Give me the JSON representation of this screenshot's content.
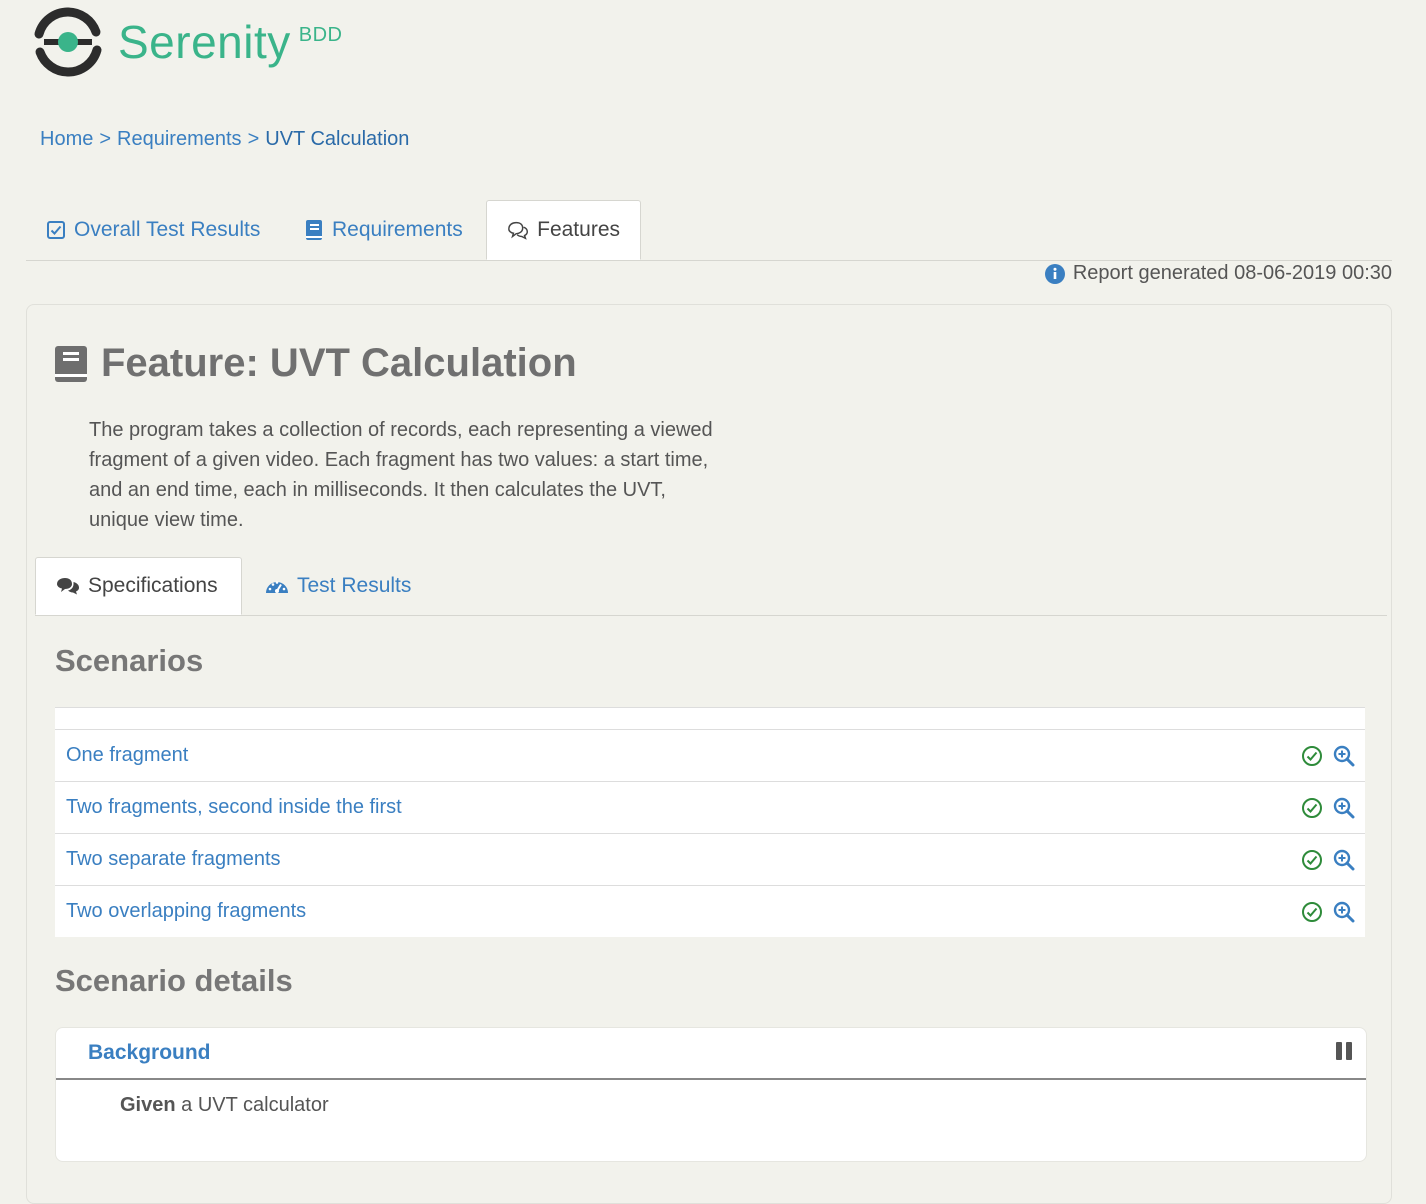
{
  "brand": {
    "name": "Serenity",
    "suffix": "BDD"
  },
  "breadcrumb": [
    {
      "label": "Home"
    },
    {
      "label": "Requirements"
    },
    {
      "label": "UVT Calculation"
    }
  ],
  "breadcrumb_sep": ">",
  "top_tabs": [
    {
      "label": "Overall Test Results",
      "icon": "checkbox-icon"
    },
    {
      "label": "Requirements",
      "icon": "book-icon"
    },
    {
      "label": "Features",
      "icon": "comments-icon",
      "active": true
    }
  ],
  "report_generated": "Report generated 08-06-2019 00:30",
  "feature": {
    "title": "Feature: UVT Calculation",
    "description": "The program takes a collection of records, each representing a viewed fragment of a given video. Each fragment has two values: a start time, and an end time, each in milliseconds. It then calculates the UVT, unique view time."
  },
  "inner_tabs": [
    {
      "label": "Specifications",
      "icon": "comments-icon",
      "active": true
    },
    {
      "label": "Test Results",
      "icon": "dashboard-icon"
    }
  ],
  "scenarios_heading": "Scenarios",
  "scenarios": [
    {
      "name": "One fragment",
      "status": "passed"
    },
    {
      "name": "Two fragments, second inside the first",
      "status": "passed"
    },
    {
      "name": "Two separate fragments",
      "status": "passed"
    },
    {
      "name": "Two overlapping fragments",
      "status": "passed"
    }
  ],
  "details_heading": "Scenario details",
  "background": {
    "title": "Background",
    "step_keyword": "Given",
    "step_text": "a UVT calculator"
  },
  "colors": {
    "brand": "#3ab48a",
    "link": "#3a7fc1",
    "passed": "#2e8b3a"
  }
}
